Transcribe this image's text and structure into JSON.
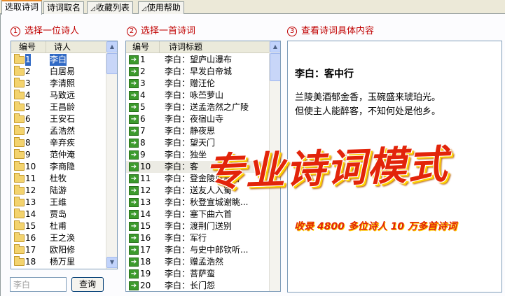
{
  "tabs": [
    {
      "label": "选取诗词",
      "active": true
    },
    {
      "label": "诗词取名",
      "active": false
    },
    {
      "label": "收藏列表",
      "active": false
    },
    {
      "label": "使用帮助",
      "active": false
    }
  ],
  "steps": [
    {
      "num": "1",
      "label": "选择一位诗人"
    },
    {
      "num": "2",
      "label": "选择一首诗词"
    },
    {
      "num": "3",
      "label": "查看诗词具体内容"
    }
  ],
  "poets": {
    "headers": [
      "编号",
      "诗人"
    ],
    "rows": [
      {
        "id": "1",
        "name": "李白"
      },
      {
        "id": "2",
        "name": "白居易"
      },
      {
        "id": "3",
        "name": "李清照"
      },
      {
        "id": "4",
        "name": "马致远"
      },
      {
        "id": "5",
        "name": "王昌龄"
      },
      {
        "id": "6",
        "name": "王安石"
      },
      {
        "id": "7",
        "name": "孟浩然"
      },
      {
        "id": "8",
        "name": "辛弃疾"
      },
      {
        "id": "9",
        "name": "范仲淹"
      },
      {
        "id": "10",
        "name": "李商隐"
      },
      {
        "id": "11",
        "name": "杜牧"
      },
      {
        "id": "12",
        "name": "陆游"
      },
      {
        "id": "13",
        "name": "王维"
      },
      {
        "id": "14",
        "name": "贾岛"
      },
      {
        "id": "15",
        "name": "杜甫"
      },
      {
        "id": "16",
        "name": "王之涣"
      },
      {
        "id": "17",
        "name": "欧阳修"
      },
      {
        "id": "18",
        "name": "杨万里"
      }
    ],
    "selected_index": 0
  },
  "poems": {
    "headers": [
      "编号",
      "诗词标题"
    ],
    "rows": [
      {
        "id": "1",
        "title": "李白：望庐山瀑布"
      },
      {
        "id": "2",
        "title": "李白：早发白帝城"
      },
      {
        "id": "3",
        "title": "李白：赠汪伦"
      },
      {
        "id": "4",
        "title": "李白：咏苎萝山"
      },
      {
        "id": "5",
        "title": "李白：送孟浩然之广陵"
      },
      {
        "id": "6",
        "title": "李白：夜宿山寺"
      },
      {
        "id": "7",
        "title": "李白：静夜思"
      },
      {
        "id": "8",
        "title": "李白：望天门"
      },
      {
        "id": "9",
        "title": "李白：独坐"
      },
      {
        "id": "10",
        "title": "李白：客"
      },
      {
        "id": "11",
        "title": "李白：登金陵凤凰台"
      },
      {
        "id": "12",
        "title": "李白：送友人入蜀"
      },
      {
        "id": "13",
        "title": "李白：秋登宣城谢眺..."
      },
      {
        "id": "14",
        "title": "李白：塞下曲六首"
      },
      {
        "id": "15",
        "title": "李白：渡荆门送别"
      },
      {
        "id": "16",
        "title": "李白：军行"
      },
      {
        "id": "17",
        "title": "李白：与史中郎钦听..."
      },
      {
        "id": "18",
        "title": "李白：赠孟浩然"
      },
      {
        "id": "19",
        "title": "李白：菩萨蛮"
      },
      {
        "id": "20",
        "title": "李白：长门怨"
      }
    ],
    "hover_index": 9
  },
  "search": {
    "placeholder": "李白",
    "button": "查询"
  },
  "poem": {
    "title": "李白：客中行",
    "lines": [
      "兰陵美酒郁金香，玉碗盛来琥珀光。",
      "但使主人能醉客，不知何处是他乡。"
    ]
  },
  "banner": "专业诗词模式",
  "tagline": "收录 4800 多位诗人 10 万多首诗词",
  "icons": {
    "folder": "folder-icon",
    "poem": "arrow-right-icon"
  },
  "colors": {
    "accent": "#c00000",
    "selection": "#316ac5",
    "banner": "#e2240a"
  }
}
